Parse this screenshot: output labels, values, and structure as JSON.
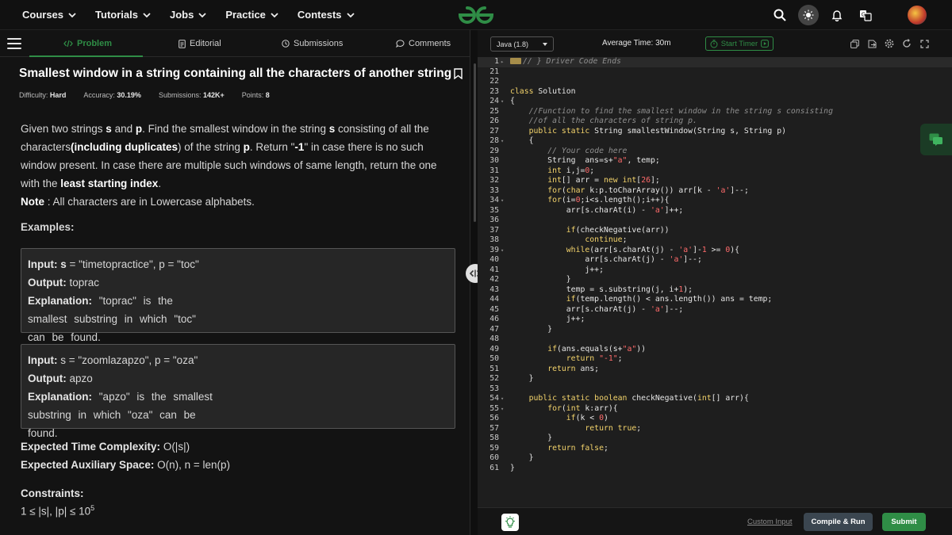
{
  "nav": {
    "items": [
      {
        "label": "Courses"
      },
      {
        "label": "Tutorials"
      },
      {
        "label": "Jobs"
      },
      {
        "label": "Practice"
      },
      {
        "label": "Contests"
      }
    ]
  },
  "tabs": {
    "problem": "Problem",
    "editorial": "Editorial",
    "submissions": "Submissions",
    "comments": "Comments"
  },
  "problem": {
    "title": "Smallest window in a string containing all the characters of another string",
    "difficulty_label": "Difficulty:",
    "difficulty": "Hard",
    "accuracy_label": "Accuracy:",
    "accuracy": "30.19%",
    "submissions_label": "Submissions:",
    "submissions": "142K+",
    "points_label": "Points:",
    "points": "8",
    "desc": {
      "p1": "Given two strings ",
      "s1": "s",
      "p2": " and ",
      "s2": "p",
      "p3": ". Find the smallest window in the string ",
      "s3": "s",
      "p4": " consisting of all the characters",
      "s4": "(including duplicates",
      "p5": ") of the string ",
      "s5": "p",
      "p6": ".  Return \"",
      "s6": "-1",
      "p7": "\" in case there is no such window present. In case there are multiple such windows of same length, return the one with the ",
      "s7": "least starting index",
      "p8": ".",
      "note_label": "Note",
      "note": " : All characters are in Lowercase alphabets."
    },
    "examples_heading": "Examples:",
    "examples": [
      {
        "input_label": "Input:",
        "input_var": " s",
        "input_text": " = \"timetopractice\", p = \"toc\"",
        "output_label": "Output:",
        "output": " toprac",
        "explanation_label": "Explanation:",
        "explanation": " \"toprac\" is the smallest substring in which \"toc\" can be found."
      },
      {
        "input_label": "Input:",
        "input_var": "",
        "input_text": " s = \"zoomlazapzo\", p = \"oza\"",
        "output_label": "Output:",
        "output": " apzo",
        "explanation_label": "Explanation:",
        "explanation": " \"apzo\" is the smallest substring in which \"oza\" can be found."
      }
    ],
    "time_label": "Expected Time Complexity:",
    "time": " O(|s|)",
    "space_label": "Expected Auxiliary Space:",
    "space": " O(n), n = len(p)",
    "constraints_label": "Constraints:",
    "constraint": "1 ≤ |s|, |p| ≤ 10",
    "constraint_exp": "5"
  },
  "editor": {
    "language": "Java (1.8)",
    "average_time": "Average Time: 30m",
    "start_timer": "Start Timer",
    "lines": [
      {
        "n": "1",
        "fold": true,
        "html": "<span class=\"foldbox\"></span><span class=\"cm\">// } Driver Code Ends</span>"
      },
      {
        "n": "21",
        "html": ""
      },
      {
        "n": "22",
        "html": ""
      },
      {
        "n": "23",
        "html": "<span class=\"kw\">class</span> Solution"
      },
      {
        "n": "24",
        "fold": true,
        "html": "{"
      },
      {
        "n": "25",
        "html": "    <span class=\"cm\">//Function to find the smallest window in the string s consisting</span>"
      },
      {
        "n": "26",
        "html": "    <span class=\"cm\">//of all the characters of string p.</span>"
      },
      {
        "n": "27",
        "html": "    <span class=\"kw\">public static</span> String smallestWindow(String s, String p)"
      },
      {
        "n": "28",
        "fold": true,
        "html": "    {"
      },
      {
        "n": "29",
        "html": "        <span class=\"cm\">// Your code here</span>"
      },
      {
        "n": "30",
        "html": "        String  ans=s+<span class=\"str\">\"a\"</span>, temp;"
      },
      {
        "n": "31",
        "html": "        <span class=\"kw\">int</span> i,j=<span class=\"num\">0</span>;"
      },
      {
        "n": "32",
        "html": "        <span class=\"kw\">int</span>[] arr = <span class=\"kw\">new int</span>[<span class=\"num\">26</span>];"
      },
      {
        "n": "33",
        "html": "        <span class=\"kw\">for</span>(<span class=\"kw\">char</span> k:p.toCharArray()) arr[k - <span class=\"str\">'a'</span>]--;"
      },
      {
        "n": "34",
        "fold": true,
        "html": "        <span class=\"kw\">for</span>(i=<span class=\"num\">0</span>;i&lt;s.length();i++){"
      },
      {
        "n": "35",
        "html": "            arr[s.charAt(i) - <span class=\"str\">'a'</span>]++;"
      },
      {
        "n": "36",
        "html": ""
      },
      {
        "n": "37",
        "html": "            <span class=\"kw\">if</span>(checkNegative(arr))"
      },
      {
        "n": "38",
        "html": "                <span class=\"kw\">continue</span>;"
      },
      {
        "n": "39",
        "fold": true,
        "html": "            <span class=\"kw\">while</span>(arr[s.charAt(j) - <span class=\"str\">'a'</span>]-<span class=\"num\">1</span> &gt;= <span class=\"num\">0</span>){"
      },
      {
        "n": "40",
        "html": "                arr[s.charAt(j) - <span class=\"str\">'a'</span>]--;"
      },
      {
        "n": "41",
        "html": "                j++;"
      },
      {
        "n": "42",
        "html": "            }"
      },
      {
        "n": "43",
        "html": "            temp = s.substring(j, i+<span class=\"num\">1</span>);"
      },
      {
        "n": "44",
        "html": "            <span class=\"kw\">if</span>(temp.length() &lt; ans.length()) ans = temp;"
      },
      {
        "n": "45",
        "html": "            arr[s.charAt(j) - <span class=\"str\">'a'</span>]--;"
      },
      {
        "n": "46",
        "html": "            j++;"
      },
      {
        "n": "47",
        "html": "        }"
      },
      {
        "n": "48",
        "html": ""
      },
      {
        "n": "49",
        "html": "        <span class=\"kw\">if</span>(ans.equals(s+<span class=\"str\">\"a\"</span>))"
      },
      {
        "n": "50",
        "html": "            <span class=\"kw\">return</span> <span class=\"str\">\"-1\"</span>;"
      },
      {
        "n": "51",
        "html": "        <span class=\"kw\">return</span> ans;"
      },
      {
        "n": "52",
        "html": "    }"
      },
      {
        "n": "53",
        "html": ""
      },
      {
        "n": "54",
        "fold": true,
        "html": "    <span class=\"kw\">public static boolean</span> checkNegative(<span class=\"kw\">int</span>[] arr){"
      },
      {
        "n": "55",
        "fold": true,
        "html": "        <span class=\"kw\">for</span>(<span class=\"kw\">int</span> k:arr){"
      },
      {
        "n": "56",
        "html": "            <span class=\"kw\">if</span>(k &lt; <span class=\"num\">0</span>)"
      },
      {
        "n": "57",
        "html": "                <span class=\"kw\">return true</span>;"
      },
      {
        "n": "58",
        "html": "        }"
      },
      {
        "n": "59",
        "html": "        <span class=\"kw\">return false</span>;"
      },
      {
        "n": "60",
        "html": "    }"
      },
      {
        "n": "61",
        "html": "}"
      }
    ]
  },
  "bottom": {
    "custom_input": "Custom Input",
    "compile_run": "Compile & Run",
    "submit": "Submit"
  },
  "colors": {
    "brand_green": "#2f8d46",
    "background": "#131313",
    "editor_bg": "#1e1e1e"
  }
}
